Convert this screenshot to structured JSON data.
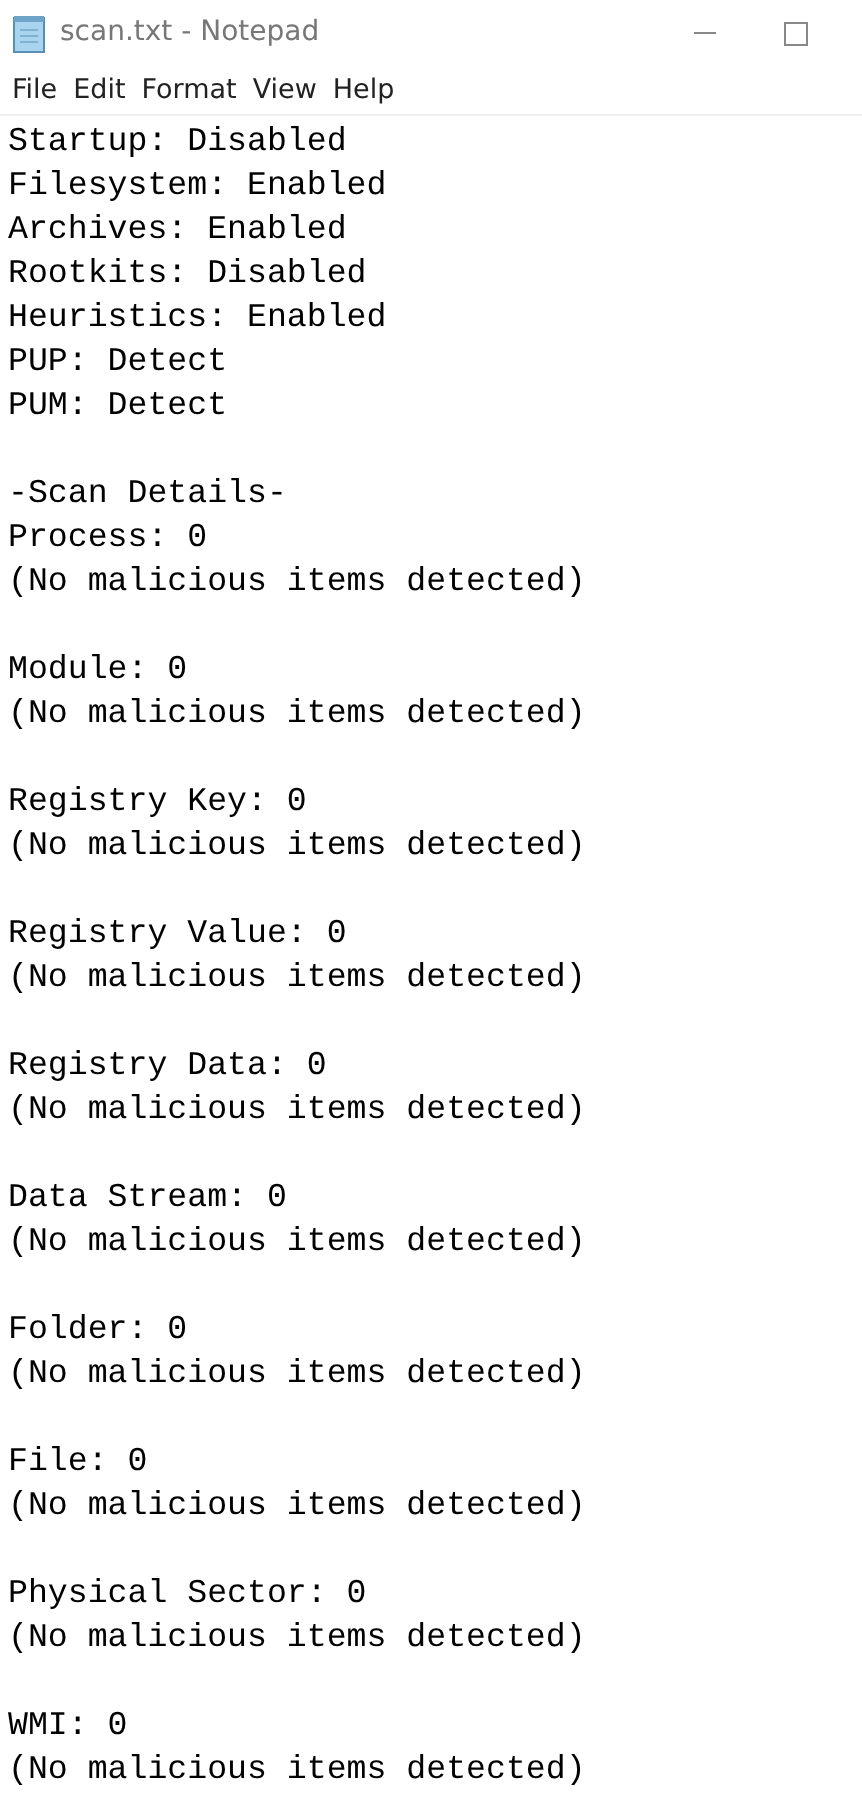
{
  "window": {
    "title": "scan.txt - Notepad"
  },
  "menu": [
    "File",
    "Edit",
    "Format",
    "View",
    "Help"
  ],
  "document": {
    "paragraphs": [
      [
        "Startup: Disabled",
        "Filesystem: Enabled",
        "Archives: Enabled",
        "Rootkits: Disabled",
        "Heuristics: Enabled",
        "PUP: Detect",
        "PUM: Detect"
      ],
      [
        "-Scan Details-",
        "Process: 0",
        "(No malicious items detected)"
      ],
      [
        "Module: 0",
        "(No malicious items detected)"
      ],
      [
        "Registry Key: 0",
        "(No malicious items detected)"
      ],
      [
        "Registry Value: 0",
        "(No malicious items detected)"
      ],
      [
        "Registry Data: 0",
        "(No malicious items detected)"
      ],
      [
        "Data Stream: 0",
        "(No malicious items detected)"
      ],
      [
        "Folder: 0",
        "(No malicious items detected)"
      ],
      [
        "File: 0",
        "(No malicious items detected)"
      ],
      [
        "Physical Sector: 0",
        "(No malicious items detected)"
      ],
      [
        "WMI: 0",
        "(No malicious items detected)"
      ]
    ]
  }
}
